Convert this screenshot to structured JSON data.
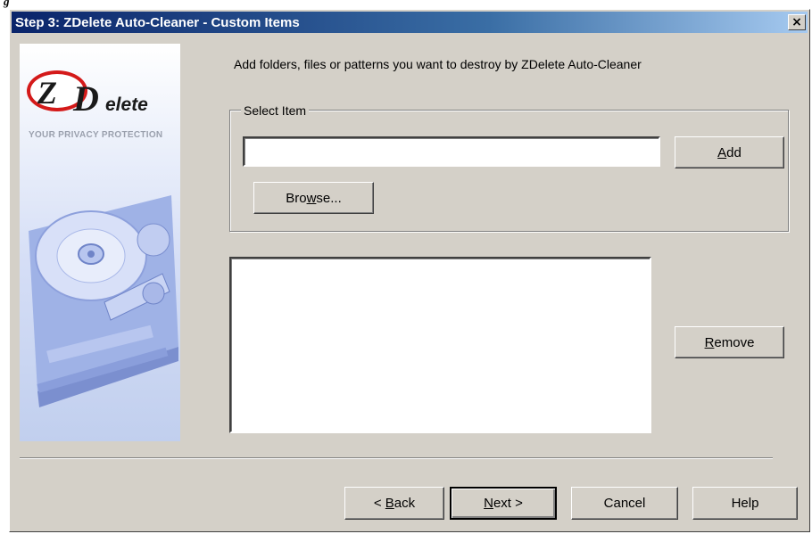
{
  "figure_label": "g",
  "window": {
    "title": "Step 3: ZDelete Auto-Cleaner - Custom Items",
    "close_glyph": "×"
  },
  "banner": {
    "logo_z": "Z",
    "logo_d": "D",
    "logo_rest": "elete",
    "tagline": "YOUR PRIVACY PROTECTION"
  },
  "instruction": "Add folders, files or patterns you want to destroy by ZDelete Auto-Cleaner",
  "select_item": {
    "group_label": "Select Item",
    "input_value": "",
    "add_label": "Add",
    "add_mnemonic": "A",
    "browse_label": "Browse...",
    "browse_mnemonic": "w"
  },
  "items_list": {
    "items": []
  },
  "remove_label": "Remove",
  "remove_mnemonic": "R",
  "footer": {
    "back_label": "< Back",
    "next_label": "Next >",
    "cancel_label": "Cancel",
    "help_label": "Help"
  }
}
